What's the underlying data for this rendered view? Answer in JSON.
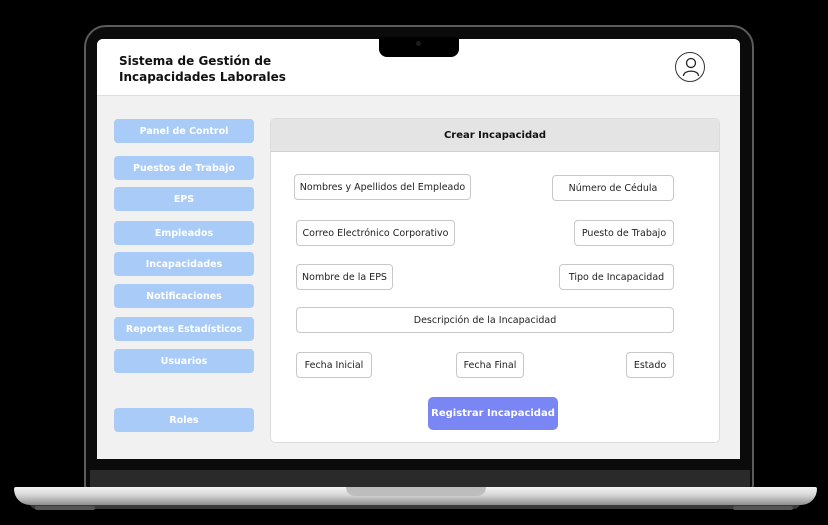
{
  "app": {
    "title_line1": "Sistema de Gestión de",
    "title_line2": "Incapacidades Laborales"
  },
  "header": {
    "avatar_icon": "user-icon"
  },
  "sidebar": {
    "items": [
      {
        "label": "Panel de Control"
      },
      {
        "label": "Puestos de Trabajo"
      },
      {
        "label": "EPS"
      },
      {
        "label": "Empleados"
      },
      {
        "label": "Incapacidades"
      },
      {
        "label": "Notificaciones"
      },
      {
        "label": "Reportes Estadísticos"
      },
      {
        "label": "Usuarios"
      },
      {
        "label": "Roles"
      }
    ]
  },
  "form": {
    "title": "Crear Incapacidad",
    "fields": {
      "employee_name": "Nombres y Apellidos del Empleado",
      "id_number": "Número de Cédula",
      "email": "Correo Electrónico Corporativo",
      "job_position": "Puesto de Trabajo",
      "eps_name": "Nombre de la EPS",
      "incapacity_type": "Tipo de Incapacidad",
      "description": "Descripción de la Incapacidad",
      "start_date": "Fecha Inicial",
      "end_date": "Fecha Final",
      "status": "Estado"
    },
    "submit_label": "Registrar Incapacidad"
  },
  "colors": {
    "sidebar_button": "#a9cbf7",
    "submit_button": "#7b86f5",
    "panel_header": "#e4e4e4",
    "screen_background": "#f1f1f1"
  }
}
